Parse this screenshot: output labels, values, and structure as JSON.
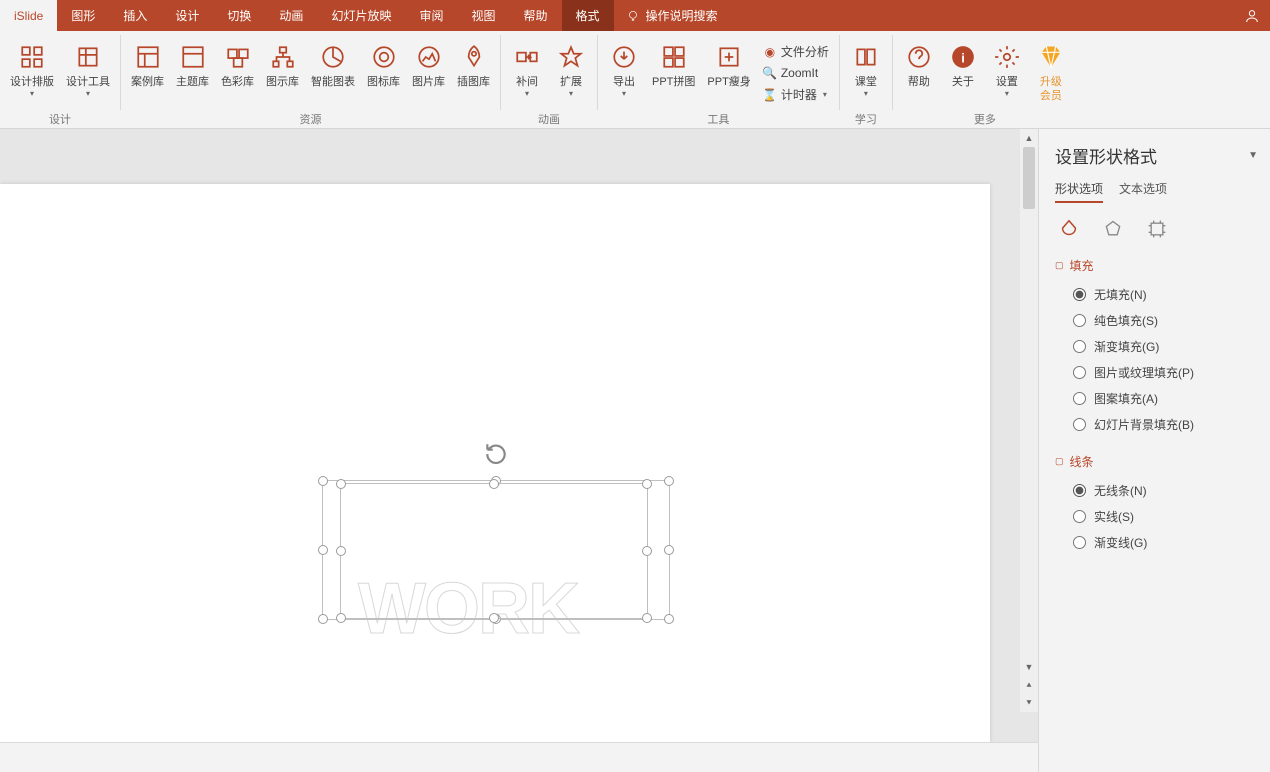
{
  "tabs": {
    "items": [
      "iSlide",
      "图形",
      "插入",
      "设计",
      "切换",
      "动画",
      "幻灯片放映",
      "审阅",
      "视图",
      "帮助",
      "格式"
    ],
    "active": "iSlide",
    "context": "格式",
    "search": "操作说明搜索"
  },
  "ribbon": {
    "g0": {
      "label": "设计",
      "b0": "设计排版",
      "b1": "设计工具"
    },
    "g1": {
      "label": "资源",
      "b0": "案例库",
      "b1": "主题库",
      "b2": "色彩库",
      "b3": "图示库",
      "b4": "智能图表",
      "b5": "图标库",
      "b6": "图片库",
      "b7": "插图库"
    },
    "g2": {
      "label": "动画",
      "b0": "补间",
      "b1": "扩展"
    },
    "g3": {
      "label": "工具",
      "b0": "导出",
      "b1": "PPT拼图",
      "b2": "PPT瘦身",
      "t0": "文件分析",
      "t1": "ZoomIt",
      "t2": "计时器"
    },
    "g4": {
      "label": "学习",
      "b0": "课堂"
    },
    "g5": {
      "label": "更多",
      "b0": "帮助",
      "b1": "关于",
      "b2": "设置",
      "b3": "升级\n会员"
    }
  },
  "canvas": {
    "text": "WORK"
  },
  "pane": {
    "title": "设置形状格式",
    "subtabs": [
      "形状选项",
      "文本选项"
    ],
    "fill": {
      "title": "填充",
      "opts": [
        "无填充(N)",
        "纯色填充(S)",
        "渐变填充(G)",
        "图片或纹理填充(P)",
        "图案填充(A)",
        "幻灯片背景填充(B)"
      ],
      "selected": 0
    },
    "line": {
      "title": "线条",
      "opts": [
        "无线条(N)",
        "实线(S)",
        "渐变线(G)"
      ],
      "selected": 0
    }
  }
}
